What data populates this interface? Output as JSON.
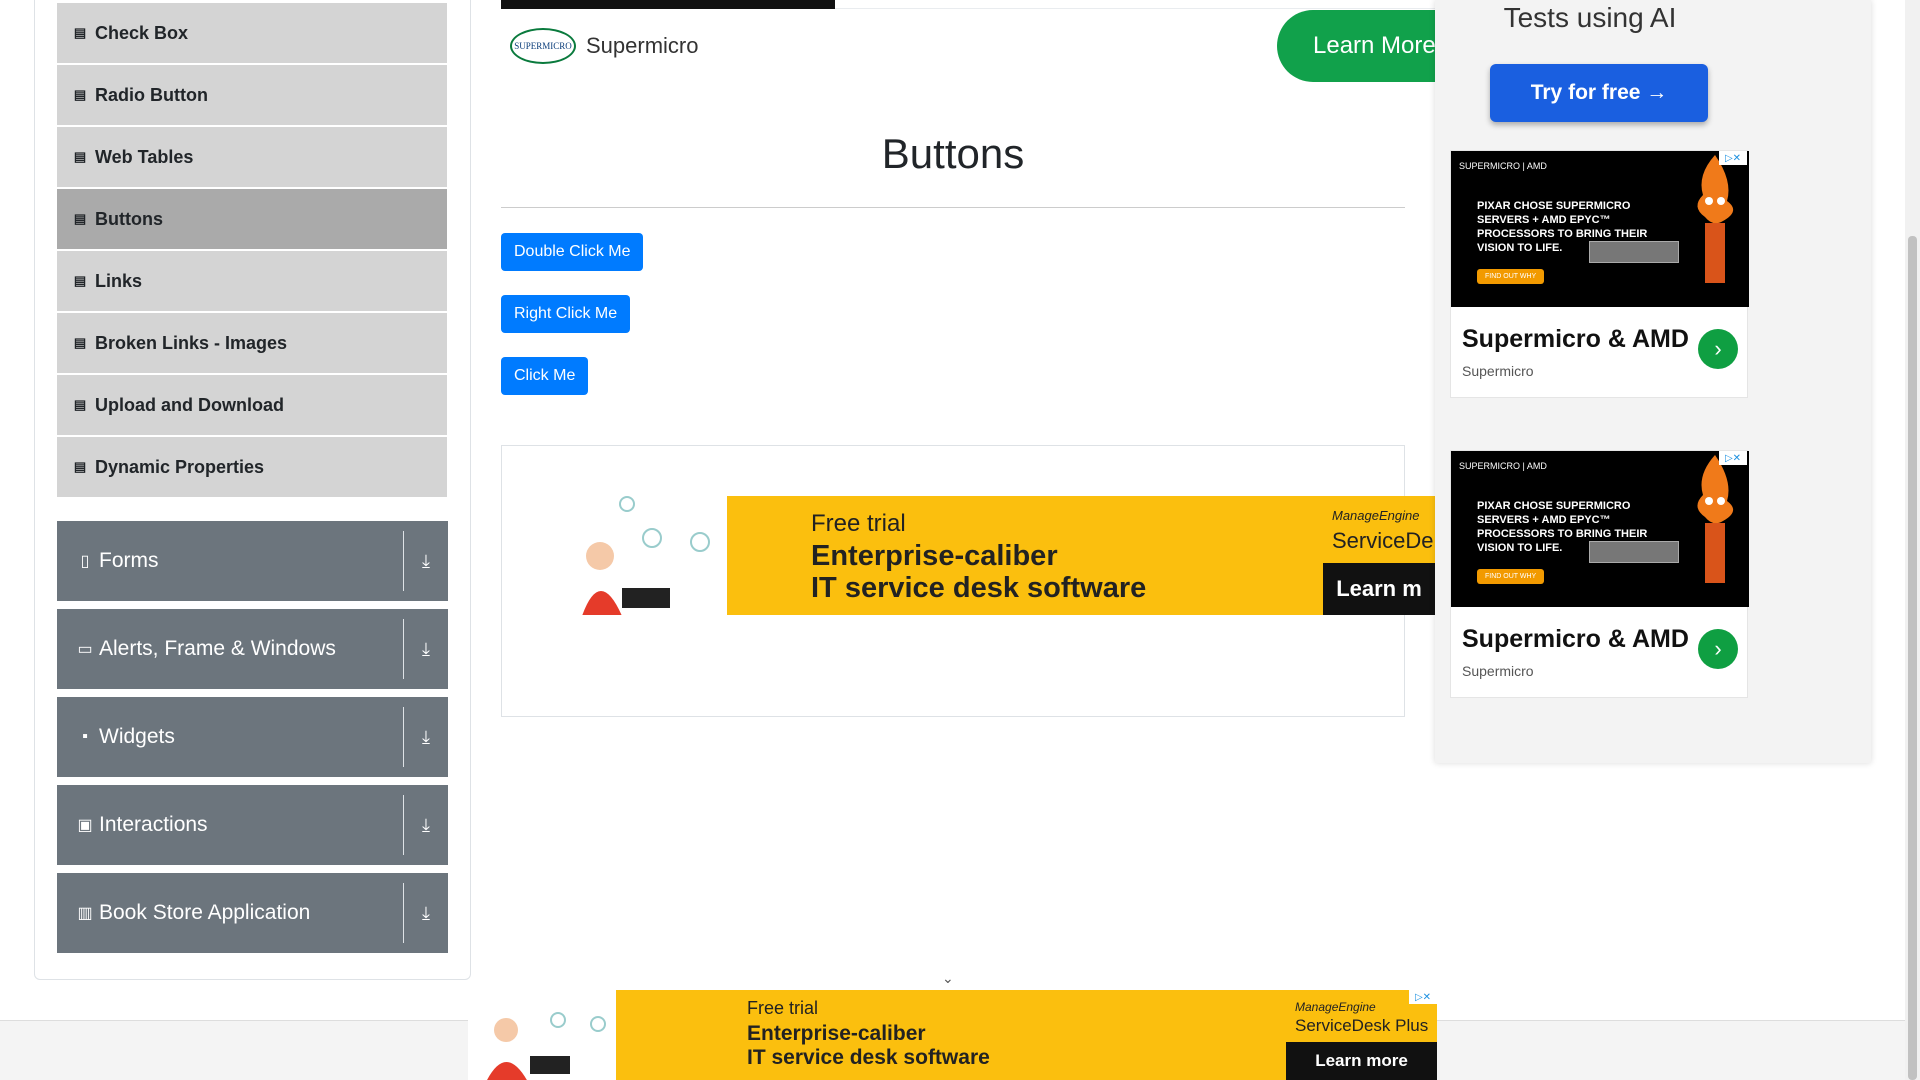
{
  "sidebar": {
    "elements_items": [
      {
        "label": "Check Box",
        "active": false
      },
      {
        "label": "Radio Button",
        "active": false
      },
      {
        "label": "Web Tables",
        "active": false
      },
      {
        "label": "Buttons",
        "active": true
      },
      {
        "label": "Links",
        "active": false
      },
      {
        "label": "Broken Links - Images",
        "active": false
      },
      {
        "label": "Upload and Download",
        "active": false
      },
      {
        "label": "Dynamic Properties",
        "active": false
      }
    ],
    "groups": [
      {
        "label": "Forms",
        "icon": "document-icon"
      },
      {
        "label": "Alerts, Frame & Windows",
        "icon": "window-icon"
      },
      {
        "label": "Widgets",
        "icon": "widgets-icon"
      },
      {
        "label": "Interactions",
        "icon": "interactions-icon"
      },
      {
        "label": "Book Store Application",
        "icon": "books-icon"
      }
    ]
  },
  "top_ad": {
    "brand": "Supermicro",
    "logo_text": "SUPERMICRO",
    "cta": "Learn More"
  },
  "main": {
    "title": "Buttons",
    "buttons": {
      "double_click": "Double Click Me",
      "right_click": "Right Click Me",
      "click": "Click Me"
    },
    "ad": {
      "free": "Free trial",
      "line1": "Enterprise-caliber",
      "line2": "IT service desk software",
      "brand_top": "ManageEngine",
      "brand_bottom": "ServiceDe",
      "cta": "Learn m"
    }
  },
  "right_ads": {
    "ai_title": "Tests using AI",
    "try_button": "Try for free →",
    "cards": [
      {
        "brand": "SUPERMICRO | AMD",
        "copy": "PIXAR CHOSE SUPERMICRO SERVERS + AMD EPYC™ PROCESSORS TO BRING THEIR VISION TO LIFE.",
        "find": "FIND OUT WHY",
        "title": "Supermicro & AMD",
        "source": "Supermicro"
      },
      {
        "brand": "SUPERMICRO | AMD",
        "copy": "PIXAR CHOSE SUPERMICRO SERVERS + AMD EPYC™ PROCESSORS TO BRING THEIR VISION TO LIFE.",
        "find": "FIND OUT WHY",
        "title": "Supermicro & AMD",
        "source": "Supermicro"
      }
    ]
  },
  "bottom_ad": {
    "free": "Free trial",
    "line1": "Enterprise-caliber",
    "line2": "IT service desk software",
    "brand_top": "ManageEngine",
    "brand_bottom": "ServiceDesk Plus",
    "cta": "Learn more"
  },
  "colors": {
    "primary": "#007bff",
    "menu_bg": "#d4d4d4",
    "menu_active": "#aaaaaa",
    "group_bg": "#6c757d",
    "ad_yellow": "#fbbf0e",
    "green": "#11a14b"
  }
}
